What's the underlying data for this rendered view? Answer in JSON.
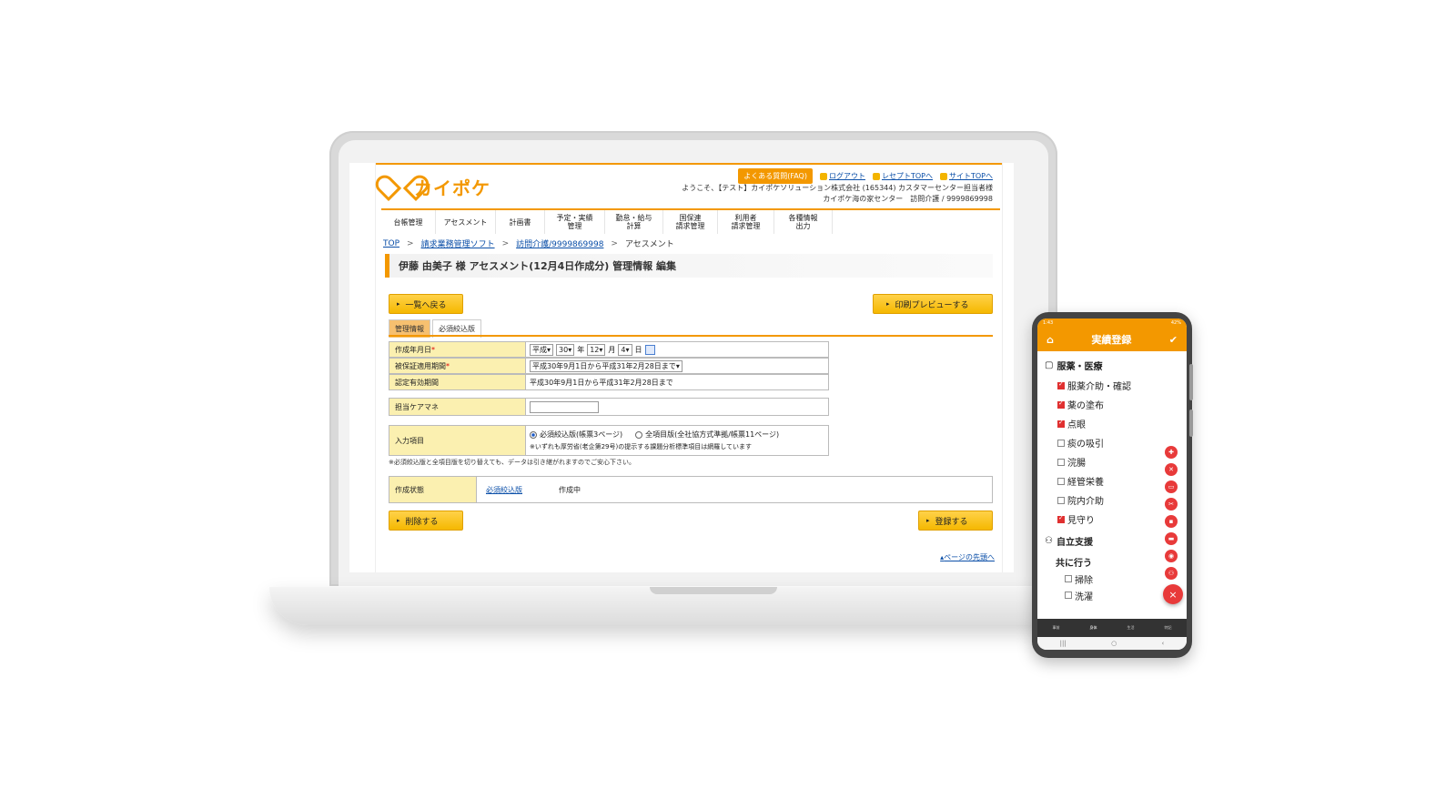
{
  "web": {
    "brand": "カイポケ",
    "toplinks": {
      "faq": "よくある質問(FAQ)",
      "logout": "ログアウト",
      "receipt_top": "レセプトTOPへ",
      "site_top": "サイトTOPへ"
    },
    "welcome_line1": "ようこそ、【テスト】カイポケソリューション株式会社 (165344) カスタマーセンター担当者様",
    "welcome_line2": "カイポケ海の家センター　訪問介護 / 9999869998",
    "nav": [
      "台帳管理",
      "アセスメント",
      "計画書",
      "予定・実績\n管理",
      "勤怠・給与計算",
      "国保連\n請求管理",
      "利用者\n請求管理",
      "各種情報\n出力"
    ],
    "breadcrumb": {
      "top": "TOP",
      "soft": "請求業務管理ソフト",
      "office": "訪問介護/9999869998",
      "current": "アセスメント"
    },
    "page_title": "伊藤 由美子 様 アセスメント(12月4日作成分) 管理情報 編集",
    "buttons": {
      "back": "一覧へ戻る",
      "print_preview": "印刷プレビューする",
      "delete": "削除する",
      "register": "登録する"
    },
    "tabs": [
      "管理情報",
      "必須絞込版"
    ],
    "form": {
      "created_date_label": "作成年月日",
      "era": "平成",
      "year": "30",
      "year_unit": "年",
      "month": "12",
      "month_unit": "月",
      "day": "4",
      "day_unit": "日",
      "insured_period_label": "被保証適用期間",
      "insured_period_value": "平成30年9月1日から平成31年2月28日まで",
      "cert_period_label": "認定有効期間",
      "cert_period_value": "平成30年9月1日から平成31年2月28日まで",
      "care_manager_label": "担当ケアマネ",
      "care_manager_value": "",
      "input_items_label": "入力項目",
      "option_required": "必須絞込版(帳票3ページ)",
      "option_full": "全項目版(全社協方式準拠/帳票11ページ)",
      "option_note": "※いずれも厚労省(老企第29号)の提示する課題分析標準項目は網羅しています",
      "switch_note": "※必須絞込版と全項目版を切り替えても、データは引き継がれますのでご安心下さい。",
      "status_label": "作成状態",
      "status_link": "必須絞込版",
      "status_value": "作成中",
      "required_mark": "*"
    },
    "page_top_link": "ページの先頭へ"
  },
  "phone": {
    "status_time": "1:43",
    "status_battery": "42%",
    "header_title": "実績登録",
    "section1": "服薬・医療",
    "items1": [
      {
        "label": "服薬介助・確認",
        "checked": true
      },
      {
        "label": "薬の塗布",
        "checked": true
      },
      {
        "label": "点眼",
        "checked": true
      },
      {
        "label": "痰の吸引",
        "checked": false
      },
      {
        "label": "浣腸",
        "checked": false
      },
      {
        "label": "経管栄養",
        "checked": false
      },
      {
        "label": "院内介助",
        "checked": false
      },
      {
        "label": "見守り",
        "checked": true
      }
    ],
    "section2": "自立支援",
    "subsection": "共に行う",
    "items2": [
      {
        "label": "掃除",
        "checked": false
      },
      {
        "label": "洗濯",
        "checked": false
      }
    ],
    "tabbar": [
      "事前",
      "身体",
      "生活",
      "特記"
    ],
    "fab": "×"
  },
  "colors": {
    "accent": "#f39800",
    "button_yellow": "#f5b800",
    "label_bg": "#fbf0b0",
    "phone_red": "#e83a3a",
    "link_blue": "#0b4fa8"
  }
}
